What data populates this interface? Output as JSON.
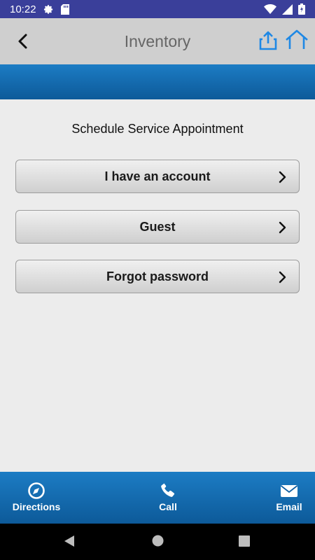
{
  "status_bar": {
    "time": "10:22"
  },
  "app_bar": {
    "title": "Inventory"
  },
  "page": {
    "heading": "Schedule Service Appointment"
  },
  "options": [
    {
      "label": "I have an account"
    },
    {
      "label": "Guest"
    },
    {
      "label": "Forgot password"
    }
  ],
  "toolbar": {
    "directions": "Directions",
    "call": "Call",
    "email": "Email"
  },
  "colors": {
    "status_bar": "#3a3f9a",
    "app_bar": "#cfcfcf",
    "accent_blue": "#1c7cc4",
    "icon_blue": "#1e88e5",
    "background": "#ececec"
  }
}
